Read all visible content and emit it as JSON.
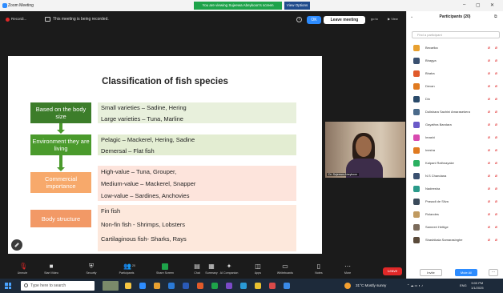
{
  "window": {
    "title": "Zoom Meeting",
    "share_banner": "You are viewing Sujeewa Abeykoon's screen",
    "view_options": "View Options"
  },
  "recording": {
    "label": "Recordi...",
    "text": "This meeting is being recorded.",
    "ok": "OK",
    "leave_meeting": "Leave meeting",
    "goto": "go to",
    "view": "View"
  },
  "slide": {
    "title": "Classification of fish species",
    "categories": [
      {
        "label": "Based on the body size",
        "items": [
          "Small varieties – Sadine, Hering",
          "Large varieties – Tuna, Marline"
        ]
      },
      {
        "label": "Environment they are living",
        "items": [
          "Pelagic – Mackerel,  Hering, Sadine",
          "Demersal – Flat fish"
        ]
      },
      {
        "label": "Commercial importance",
        "items": [
          "High-value – Tuna, Grouper,",
          "Medium-value – Mackerel, Snapper",
          "Low-value – Sardines, Anchovies"
        ]
      },
      {
        "label": "Body structure",
        "items": [
          "Fin fish",
          "Non-fin fish -  Shrimps, Lobsters",
          "Cartilaginous fish- Sharks, Rays"
        ]
      }
    ]
  },
  "speaker": {
    "name": "Dr. Sujeewa Abeykoon"
  },
  "toolbar": {
    "buttons": [
      "Unmute",
      "Start Video",
      "Security",
      "Participants",
      "Share Screen",
      "Chat",
      "Summary",
      "AI Companion",
      "Apps",
      "Whiteboards",
      "Notes",
      "More"
    ],
    "participants_count": "20",
    "leave": "Leave"
  },
  "panel": {
    "title": "Participants (20)",
    "search_placeholder": "Find a participant",
    "participants": [
      {
        "name": "Becarika",
        "color": "#e8a030"
      },
      {
        "name": "Bhagya",
        "color": "#3a5070"
      },
      {
        "name": "Bhaba",
        "color": "#e05a2a"
      },
      {
        "name": "Devan",
        "color": "#e07a20"
      },
      {
        "name": "Din",
        "color": "#2a4a6a"
      },
      {
        "name": "Dulishara Sachini Amarasekera",
        "color": "#4a6a8a"
      },
      {
        "name": "Gayathra Bandara",
        "color": "#6a5ac8"
      },
      {
        "name": "Imashi",
        "color": "#d84ab0"
      },
      {
        "name": "Inesha",
        "color": "#e07a20"
      },
      {
        "name": "Kalpani Rathnayake",
        "color": "#2ab060"
      },
      {
        "name": "N.S Chandana",
        "color": "#3a5070"
      },
      {
        "name": "Nadeesha",
        "color": "#2a9a8a"
      },
      {
        "name": "Prasadi de Silva",
        "color": "#3a4a5a"
      },
      {
        "name": "Rolandes",
        "color": "#c09a60"
      },
      {
        "name": "Sameeri Hettige",
        "color": "#7a6a5a"
      },
      {
        "name": "Shashikala Samarasinghe",
        "color": "#5a4a3a"
      }
    ],
    "invite": "Invite",
    "mute_all": "Mute All",
    "more": "..."
  },
  "taskbar": {
    "search_placeholder": "Type here to search",
    "weather": "31°C  Mostly sunny",
    "lang": "ENG",
    "time": "9:00 PM",
    "date": "1/1/2025"
  },
  "colors": {
    "zoom_blue": "#2d8cff",
    "leave_red": "#e02828",
    "share_green": "#1ea34a"
  }
}
